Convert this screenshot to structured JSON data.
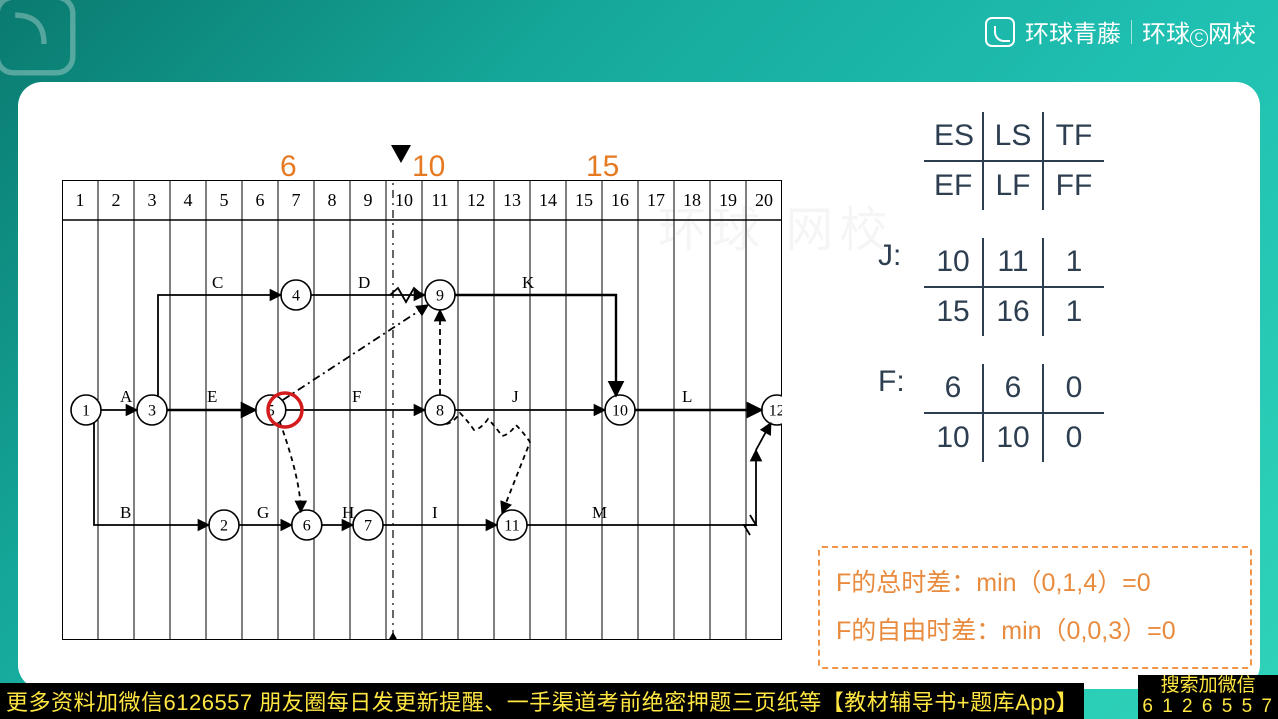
{
  "brand": {
    "title1": "环球青藤",
    "title2_a": "环球",
    "title2_b": "网校",
    "circ": "C"
  },
  "timeline": {
    "labels": [
      "1",
      "2",
      "3",
      "4",
      "5",
      "6",
      "7",
      "8",
      "9",
      "10",
      "11",
      "12",
      "13",
      "14",
      "15",
      "16",
      "17",
      "18",
      "19",
      "20"
    ],
    "markers": {
      "six": "6",
      "ten": "10",
      "fifteen": "15"
    }
  },
  "nodes": {
    "n1": "1",
    "n2": "2",
    "n3": "3",
    "n4": "4",
    "n5": "5",
    "n6": "6",
    "n7": "7",
    "n8": "8",
    "n9": "9",
    "n10": "10",
    "n11": "11",
    "n12": "12"
  },
  "activities": {
    "A": "A",
    "B": "B",
    "C": "C",
    "D": "D",
    "E": "E",
    "F": "F",
    "G": "G",
    "H": "H",
    "I": "I",
    "J": "J",
    "K": "K",
    "L": "L",
    "M": "M"
  },
  "legend": {
    "es": "ES",
    "ls": "LS",
    "tf": "TF",
    "ef": "EF",
    "lf": "LF",
    "ff": "FF"
  },
  "J": {
    "label": "J:",
    "es": "10",
    "ls": "11",
    "tf": "1",
    "ef": "15",
    "lf": "16",
    "ff": "1"
  },
  "F": {
    "label": "F:",
    "es": "6",
    "ls": "6",
    "tf": "0",
    "ef": "10",
    "lf": "10",
    "ff": "0"
  },
  "note": {
    "line1": "F的总时差：min（0,1,4）=0",
    "line2": "F的自由时差：min（0,0,3）=0"
  },
  "footer": {
    "left": "更多资料加微信6126557 朋友圈每日发更新提醒、一手渠道考前绝密押题三页纸等【教材辅导书+题库App】",
    "right_l1": "搜索加微信",
    "right_l2": "6 1 2 6 5 5 7"
  },
  "watermark": "环球 网校"
}
